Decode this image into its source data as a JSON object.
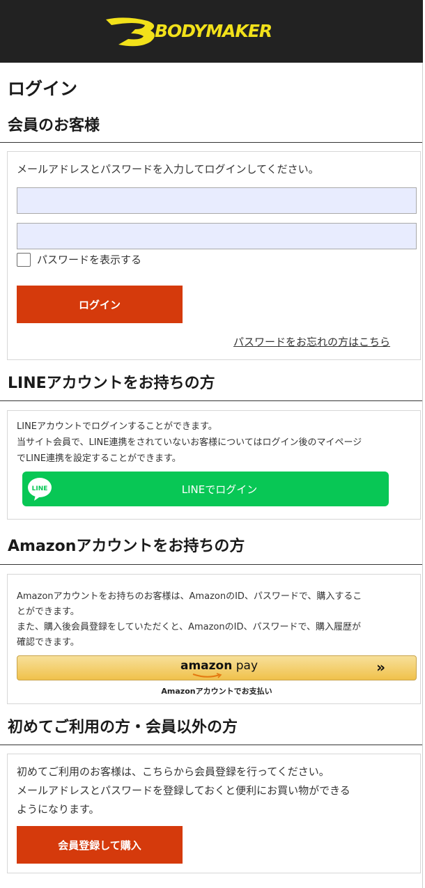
{
  "header": {
    "brand": "BODYMAKER"
  },
  "page": {
    "title": "ログイン"
  },
  "member": {
    "title": "会員のお客様",
    "instruction": "メールアドレスとパスワードを入力してログインしてください。",
    "email_value": "",
    "password_value": "",
    "show_password_label": "パスワードを表示する",
    "login_label": "ログイン",
    "forgot_label": "パスワードをお忘れの方はこちら"
  },
  "line": {
    "title": "LINEアカウントをお持ちの方",
    "desc": [
      "LINEアカウントでログインすることができます。",
      "当サイト会員で、LINE連携をされていないお客様についてはログイン後のマイページ",
      "でLINE連携を設定することができます。"
    ],
    "icon_text": "LINE",
    "button_label": "LINEでログイン"
  },
  "amazon": {
    "title": "Amazonアカウントをお持ちの方",
    "desc": [
      "Amazonアカウントをお持ちのお客様は、AmazonのID、パスワードで、購入するこ",
      "とができます。",
      "また、購入後会員登録をしていただくと、AmazonのID、パスワードで、購入履歴が",
      "確認できます。"
    ],
    "logo_text": "amazon",
    "pay_text": " pay",
    "arrows": "»",
    "caption": "Amazonアカウントでお支払い"
  },
  "guest": {
    "title": "初めてご利用の方・会員以外の方",
    "desc": [
      "初めてご利用のお客様は、こちらから会員登録を行ってください。",
      "メールアドレスとパスワードを登録しておくと便利にお買い物ができる",
      "ようになります。"
    ],
    "register_label": "会員登録して購入"
  },
  "colors": {
    "header_bg": "#222222",
    "brand_yellow": "#f2e11a",
    "button_red": "#d53a0c",
    "line_green": "#08c755",
    "amazon_gold": "#f0c14b",
    "input_bg": "#e8ecfe"
  },
  "icons": [
    "bodymaker-logo-icon",
    "line-logo-icon",
    "amazon-smile-icon",
    "double-chevron-right-icon",
    "checkbox-icon"
  ]
}
